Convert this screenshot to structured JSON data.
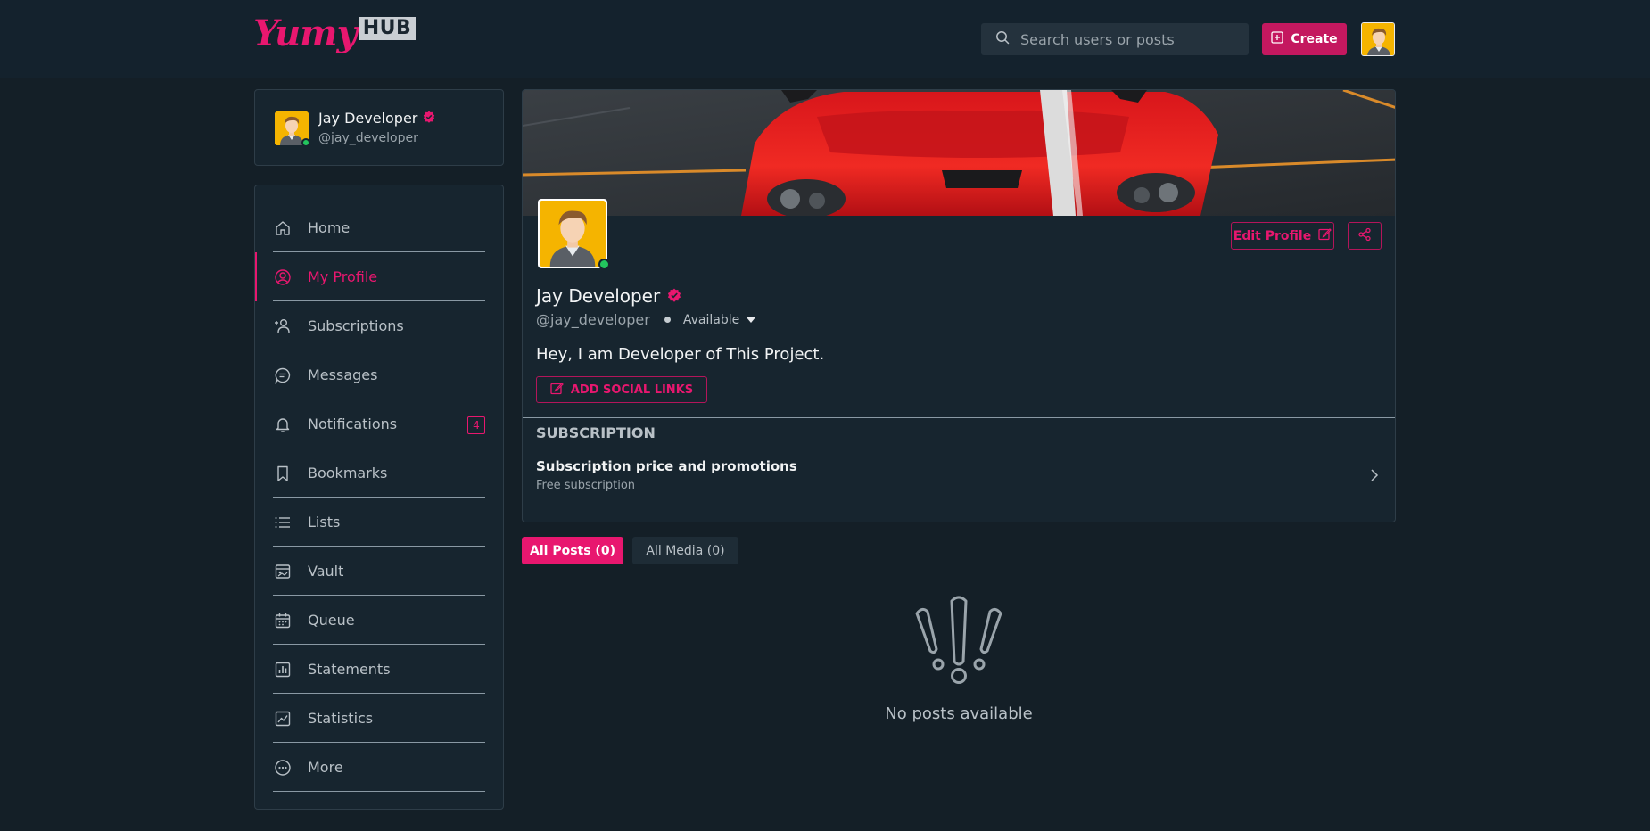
{
  "header": {
    "logo_main": "Yumy",
    "logo_badge": "HUB",
    "search_placeholder": "Search users or posts",
    "create_label": "Create"
  },
  "user_card": {
    "name": "Jay Developer",
    "handle": "@jay_developer"
  },
  "sidebar": {
    "items": [
      {
        "label": "Home",
        "icon": "home-icon"
      },
      {
        "label": "My Profile",
        "icon": "user-circle-icon",
        "active": true
      },
      {
        "label": "Subscriptions",
        "icon": "user-plus-icon"
      },
      {
        "label": "Messages",
        "icon": "message-icon"
      },
      {
        "label": "Notifications",
        "icon": "bell-icon",
        "badge": "4"
      },
      {
        "label": "Bookmarks",
        "icon": "bookmark-icon"
      },
      {
        "label": "Lists",
        "icon": "list-icon"
      },
      {
        "label": "Vault",
        "icon": "vault-icon"
      },
      {
        "label": "Queue",
        "icon": "calendar-icon"
      },
      {
        "label": "Statements",
        "icon": "bar-chart-icon"
      },
      {
        "label": "Statistics",
        "icon": "line-chart-icon"
      },
      {
        "label": "More",
        "icon": "more-icon"
      }
    ]
  },
  "profile": {
    "name": "Jay Developer",
    "handle": "@jay_developer",
    "status": "Available",
    "bio": "Hey, I am Developer of This Project.",
    "edit_label": "Edit Profile",
    "social_label": "ADD SOCIAL LINKS"
  },
  "subscription": {
    "heading": "SUBSCRIPTION",
    "title": "Subscription price and promotions",
    "desc": "Free subscription"
  },
  "tabs": {
    "all_posts": "All Posts (0)",
    "all_media": "All Media (0)"
  },
  "empty": {
    "text": "No posts available"
  },
  "colors": {
    "accent": "#e8176f",
    "background": "#141f27",
    "card": "#17252f",
    "online": "#23c55e"
  }
}
